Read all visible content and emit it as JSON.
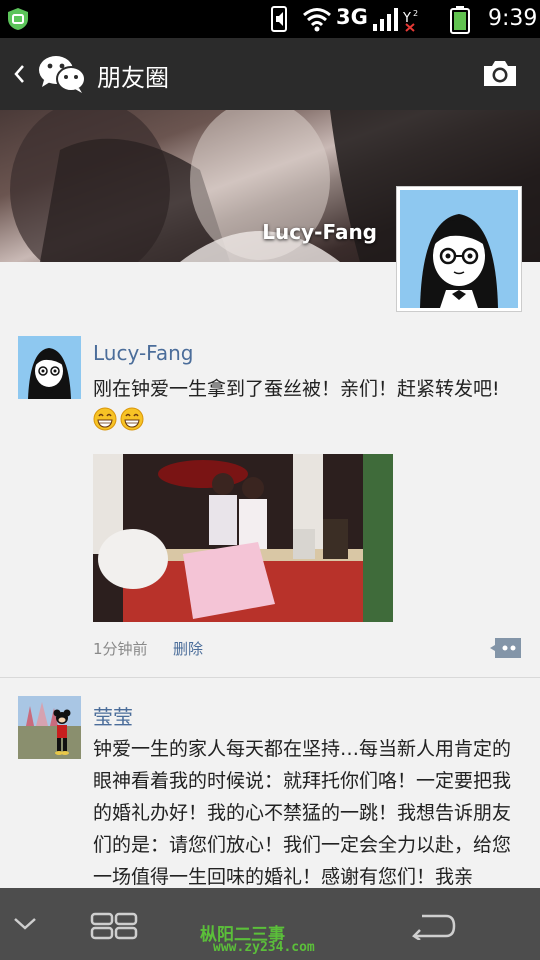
{
  "status_bar": {
    "network": "3G",
    "time": "9:39"
  },
  "title_bar": {
    "title": "朋友圈"
  },
  "cover": {
    "owner_name": "Lucy-Fang"
  },
  "posts": [
    {
      "username": "Lucy-Fang",
      "text": "刚在钟爱一生拿到了蚕丝被！亲们！赶紧转发吧!",
      "time": "1分钟前",
      "delete_label": "删除"
    },
    {
      "username": "莹莹",
      "text": "钟爱一生的家人每天都在坚持…每当新人用肯定的眼神看着我的时候说：就拜托你们咯！一定要把我的婚礼办好！我的心不禁猛的一跳！我想告诉朋友们的是：请您们放心！我们一定会全力以赴，给您一场值得一生回味的婚礼！感谢有您们！我亲"
    }
  ],
  "watermark": {
    "line1": "枞阳二三事",
    "line2": "www.zy234.com"
  },
  "colors": {
    "link_blue": "#4b6d9a",
    "title_bar": "#2b2b2b",
    "nav_bar": "#4d4d4d"
  },
  "icons": [
    "shield-icon",
    "mute-icon",
    "wifi-icon",
    "signal-icon",
    "battery-icon",
    "back-icon",
    "wechat-icon",
    "camera-icon",
    "comment-icon",
    "grin-emoji-icon",
    "collapse-icon",
    "recent-apps-icon",
    "back-arrow-icon"
  ]
}
